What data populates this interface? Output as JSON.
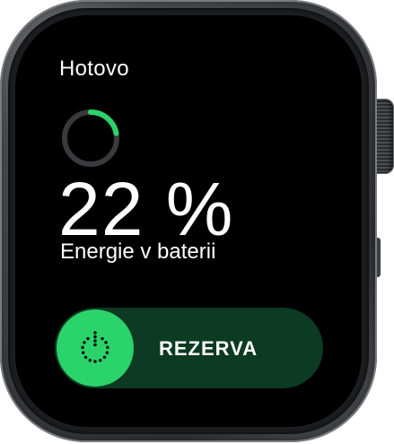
{
  "screen": {
    "done_label": "Hotovo",
    "battery_percent_text": "22 %",
    "battery_level": 0.22,
    "energy_label": "Energie v baterii",
    "reserve": {
      "label": "REZERVA",
      "icon": "power-reserve-icon"
    }
  },
  "colors": {
    "accent_green": "#2bd36b",
    "track_green": "#0c3a23",
    "ring_track": "#3a3a3c",
    "text": "#ffffff",
    "background": "#000000"
  },
  "device": {
    "hardware": [
      "digital-crown",
      "side-button"
    ]
  }
}
